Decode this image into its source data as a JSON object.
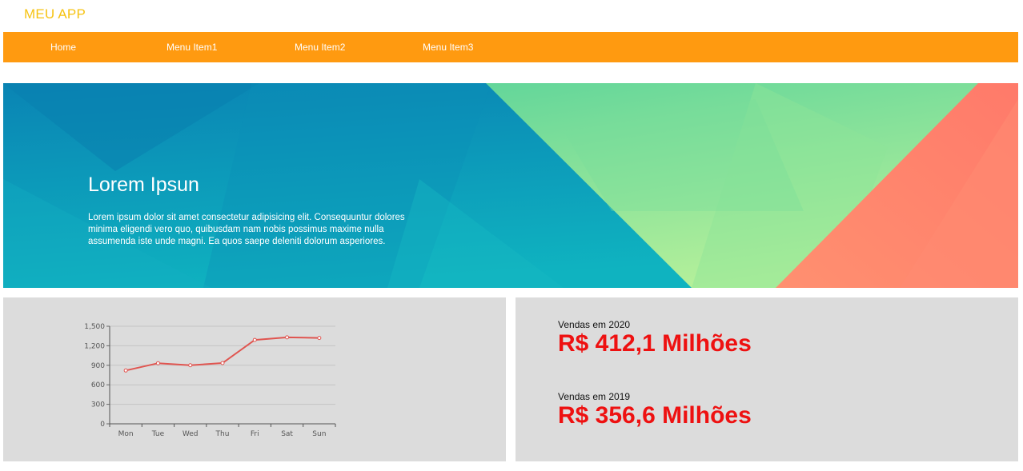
{
  "app": {
    "title": "MEU APP"
  },
  "nav": {
    "items": [
      {
        "label": "Home"
      },
      {
        "label": "Menu Item1"
      },
      {
        "label": "Menu Item2"
      },
      {
        "label": "Menu Item3"
      }
    ]
  },
  "hero": {
    "title": "Lorem Ipsun",
    "text": "Lorem ipsum dolor sit amet consectetur adipisicing elit. Consequuntur dolores minima eligendi vero quo, quibusdam nam nobis possimus maxime nulla assumenda iste unde magni. Ea quos saepe deleniti dolorum asperiores."
  },
  "sales": [
    {
      "label": "Vendas em 2020",
      "value": "R$ 412,1 Milhões"
    },
    {
      "label": "Vendas em 2019",
      "value": "R$ 356,6 Milhões"
    }
  ],
  "colors": {
    "brand": "#f6c312",
    "nav": "#ff9a10",
    "sales_value": "#ee1111",
    "line": "#e05550"
  },
  "chart_data": {
    "type": "line",
    "categories": [
      "Mon",
      "Tue",
      "Wed",
      "Thu",
      "Fri",
      "Sat",
      "Sun"
    ],
    "series": [
      {
        "values": [
          820,
          932,
          901,
          934,
          1290,
          1330,
          1320
        ]
      }
    ],
    "yticks": [
      "0",
      "300",
      "600",
      "900",
      "1,200",
      "1,500"
    ],
    "ylim": [
      0,
      1500
    ],
    "grid": true
  }
}
